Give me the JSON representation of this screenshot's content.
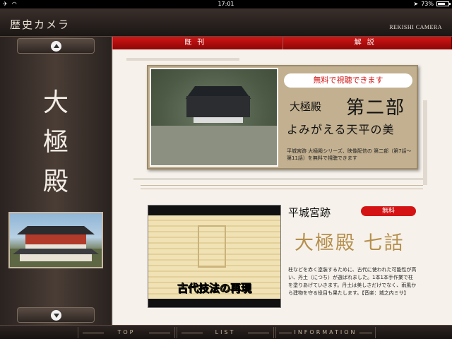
{
  "status": {
    "time": "17:01",
    "battery": "73%",
    "battery_level": 0.73
  },
  "header": {
    "title": "歴史カメラ",
    "brand": "REKISHI CAMERA"
  },
  "sidebar": {
    "title_chars": [
      "大",
      "極",
      "殿"
    ]
  },
  "tabs": [
    {
      "label": "既刊"
    },
    {
      "label": "解説"
    }
  ],
  "card1": {
    "badge": "無料で視聴できます",
    "name": "大極殿",
    "part": "第二部",
    "subtitle": "よみがえる天平の美",
    "description": "平城宮跡 大極殿シリーズ、映像配信の 第二部（第7話〜第11話）を無料で視聴できます"
  },
  "card2": {
    "caption": "古代技法の再現",
    "place": "平城宮跡",
    "badge": "無料",
    "episode": "大極殿 七話",
    "description": "柱などを赤く塗装するために、古代に使われた可能性が高い、丹土（につち）が選ばれました。1本1本手作業で柱を塗りあげていきます。丹土は美しさだけでなく、雨風から建物を守る役目も果たします。【音楽：城之内ミサ】"
  },
  "bottom_nav": [
    {
      "label": "TOP"
    },
    {
      "label": "LIST"
    },
    {
      "label": "INFORMATION"
    }
  ],
  "colors": {
    "accent_red": "#d21515",
    "gold_text": "#b58f4d",
    "card_tan": "#c2b090"
  }
}
